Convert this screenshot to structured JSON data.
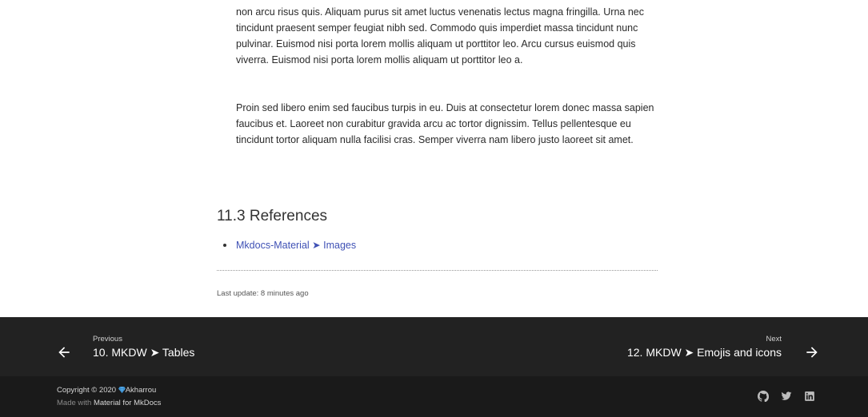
{
  "content": {
    "para1": "non arcu risus quis. Aliquam purus sit amet luctus venenatis lectus magna fringilla. Urna nec tincidunt praesent semper feugiat nibh sed. Commodo quis imperdiet massa tincidunt nunc pulvinar. Euismod nisi porta lorem mollis aliquam ut porttitor leo. Arcu cursus euismod quis viverra. Euismod nisi porta lorem mollis aliquam ut porttitor leo a.",
    "para2": "Proin sed libero enim sed faucibus turpis in eu. Duis at consectetur lorem donec massa sapien faucibus et. Laoreet non curabitur gravida arcu ac tortor dignissim. Tellus pellentesque eu tincidunt tortor aliquam nulla facilisi cras. Semper viverra nam libero justo laoreet sit amet.",
    "references_heading": "11.3 References",
    "references": [
      {
        "label": "Mkdocs-Material ➤ Images"
      }
    ],
    "last_update": "Last update: 8 minutes ago"
  },
  "footer": {
    "prev": {
      "direction": "Previous",
      "title": "10. MKDW ➤ Tables"
    },
    "next": {
      "direction": "Next",
      "title": "12. MKDW ➤ Emojis and icons"
    },
    "copyright_prefix": "Copyright © 2020 ",
    "copyright_owner": "Akharrou",
    "made_with_prefix": "Made with ",
    "made_with_link": "Material for MkDocs",
    "social": [
      "github-icon",
      "twitter-icon",
      "linkedin-icon"
    ]
  },
  "colors": {
    "link": "#3f51b5",
    "footer_nav_bg": "#222222",
    "footer_meta_bg": "#1a1a1a",
    "gem": "#4fa3e0"
  }
}
